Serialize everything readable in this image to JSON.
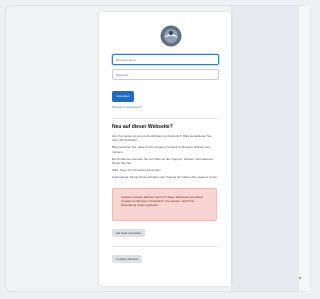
{
  "login": {
    "username_placeholder": "Benutzername",
    "password_placeholder": "Passwort",
    "submit_label": "Anmelden",
    "forgot_link": "Kennwort vergessen?"
  },
  "info": {
    "heading": "Neu auf dieser Webseite?",
    "paragraphs": [
      "Zum Anmelden ist eine Authentifizierung erforderlich. Bitte kontaktieren Sie Ihren Administrator.",
      "Bitte beachten Sie, dass für den Zugang Cookies im Browser aktiviert sein müssen.",
      "Bei Problemen wenden Sie sich bitte an den Support. Weitere Informationen finden Sie hier.",
      "Hilfe: Tipps zur Anmeldung anzeigen",
      "Gastzugang: Einige Kurse erlauben den Zugang für Gäste ohne eigenes Konto."
    ]
  },
  "alert": {
    "text": "Cookies müssen aktiviert sein! Für diese Webseite sind aktive Cookies im Browser erforderlich. Sie werden nach Ihrer Abmeldung wieder gelöscht."
  },
  "buttons": {
    "guest_label": "Als Gast anmelden",
    "cookies_label": "Cookies-Hinweis"
  },
  "side": {
    "fold_icon": "chevron-down-icon"
  }
}
